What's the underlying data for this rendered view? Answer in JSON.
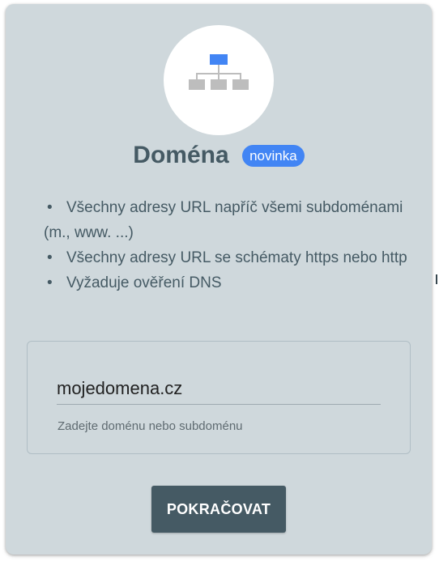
{
  "card": {
    "title": "Doména",
    "badge": "novinka",
    "features": [
      "Všechny adresy URL napříč všemi subdoménami (m., www. ...)",
      "Všechny adresy URL se schématy https nebo http",
      "Vyžaduje ověření DNS"
    ],
    "bullet": "•",
    "domain_input": {
      "value": "mojedomena.cz",
      "helper": "Zadejte doménu nebo subdoménu"
    },
    "continue_label": "POKRAČOVAT",
    "icon": "sitemap-icon"
  },
  "colors": {
    "card_background": "#cfd8dc",
    "title": "#455a64",
    "badge": "#4285f4",
    "button": "#455a64",
    "icon_top_node": "#4285f4",
    "icon_nodes": "#bdbdbd"
  }
}
